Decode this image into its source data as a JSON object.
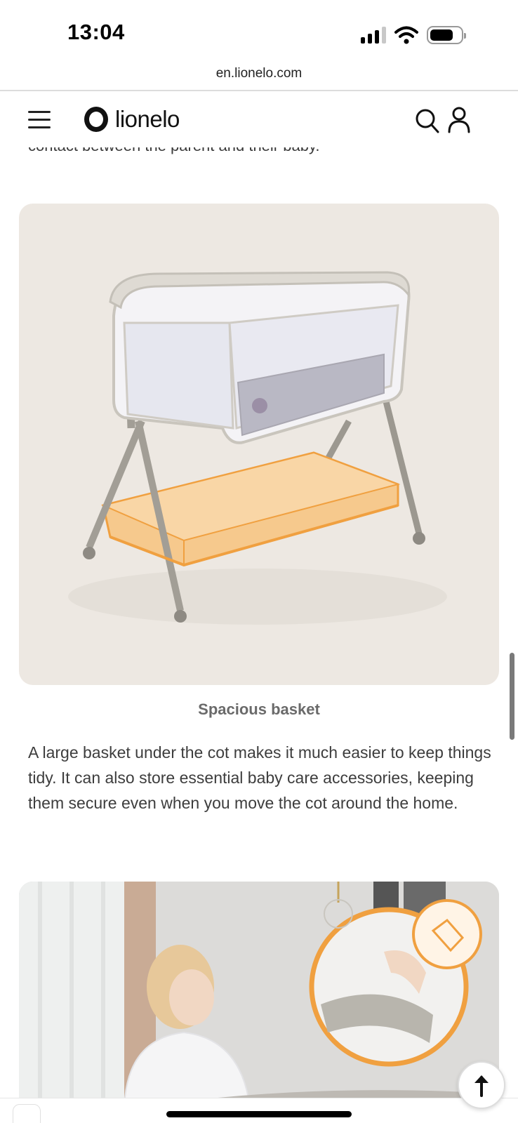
{
  "status_bar": {
    "time": "13:04"
  },
  "browser": {
    "url": "en.lionelo.com"
  },
  "header": {
    "brand": "lionelo",
    "icons": {
      "menu": "hamburger-menu-icon",
      "search": "search-icon",
      "account": "user-icon"
    }
  },
  "content": {
    "partial_line": "contact between the parent and their baby.",
    "feature_title": "Spacious basket",
    "feature_body": "A large basket under the cot makes it much easier to keep things tidy. It can also store essential baby care accessories, keeping them secure even when you move the cot around the home."
  },
  "colors": {
    "accent": "#f0a040",
    "card_bg": "#ede8e2",
    "text": "#3d3d3d",
    "title": "#6a6a6a"
  },
  "back_to_top": {
    "icon": "arrow-up-icon"
  }
}
